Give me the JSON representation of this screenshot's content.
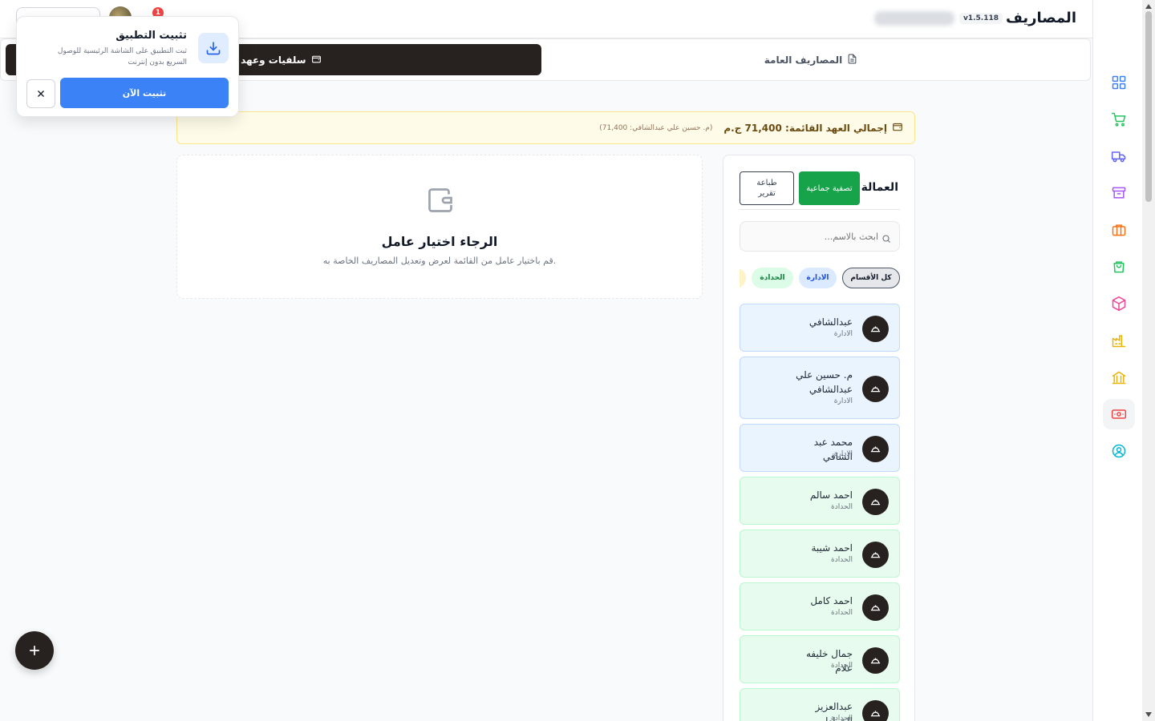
{
  "header": {
    "title": "المصاريف",
    "version": "v1.5.118",
    "notification_count": "1"
  },
  "tabs": [
    {
      "label": "المصاريف العامة",
      "icon": "file-text-icon"
    },
    {
      "label": "سلفيات وعهد ال",
      "icon": "wallet-icon"
    }
  ],
  "banner": {
    "title": "إجمالي العهد القائمة: 71,400 ج.م",
    "detail": "(م. حسين علي عبدالشافي: 71,400)"
  },
  "workers_panel": {
    "title": "العمالة",
    "settle_label": "تصفية جماعية",
    "print_label": "طباعة تقرير",
    "search_placeholder": "ابحث بالاسم...",
    "filters": [
      "كل الأقسام",
      "الادارة",
      "الحدادة"
    ],
    "workers": [
      {
        "name": "عبدالشافي",
        "dept": "الادارة",
        "theme": "blue"
      },
      {
        "name": "م. حسين علي عبدالشافي",
        "dept": "الادارة",
        "theme": "blue"
      },
      {
        "name": "محمد عبد الشافي",
        "dept": "الادارة",
        "theme": "blue"
      },
      {
        "name": "احمد سالم",
        "dept": "الحدادة",
        "theme": "green"
      },
      {
        "name": "احمد شيبة",
        "dept": "الحدادة",
        "theme": "green"
      },
      {
        "name": "احمد كامل",
        "dept": "الحدادة",
        "theme": "green"
      },
      {
        "name": "جمال خليفه علام",
        "dept": "الحدادة",
        "theme": "green"
      },
      {
        "name": "عبدالعزيز الخراط",
        "dept": "الحدادة",
        "theme": "green"
      }
    ]
  },
  "empty_state": {
    "title": "الرجاء اختيار عامل",
    "subtitle": "قم باختيار عامل من القائمة لعرض وتعديل المصاريف الخاصة به."
  },
  "install_popup": {
    "title": "تثبيت التطبيق",
    "description": "ثبت التطبيق على الشاشة الرئيسية للوصول السريع بدون إنترنت",
    "install_label": "تثبيت الآن"
  },
  "sidebar": {
    "items": [
      {
        "name": "dashboard-icon",
        "color": "#3b82f6"
      },
      {
        "name": "cart-icon",
        "color": "#22c55e"
      },
      {
        "name": "truck-icon",
        "color": "#6366f1"
      },
      {
        "name": "archive-icon",
        "color": "#a855f7"
      },
      {
        "name": "briefcase-icon",
        "color": "#f97316"
      },
      {
        "name": "shopping-bag-icon",
        "color": "#22c55e"
      },
      {
        "name": "package-icon",
        "color": "#ec4899"
      },
      {
        "name": "factory-icon",
        "color": "#eab308"
      },
      {
        "name": "bank-icon",
        "color": "#eab308"
      },
      {
        "name": "banknote-icon",
        "color": "#ef4444",
        "active": true
      },
      {
        "name": "user-circle-icon",
        "color": "#06b6d4"
      }
    ]
  }
}
